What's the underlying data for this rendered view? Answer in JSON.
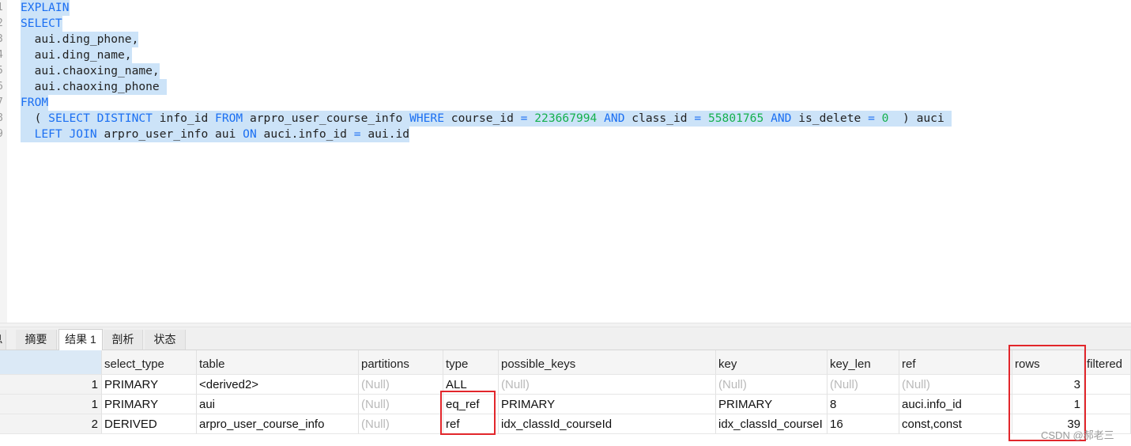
{
  "editor": {
    "line_numbers": [
      "1",
      "2",
      "3",
      "4",
      "5",
      "6",
      "7",
      "8",
      "9"
    ],
    "lines": [
      [
        {
          "t": "EXPLAIN",
          "c": "kw"
        }
      ],
      [
        {
          "t": "SELECT",
          "c": "kw"
        }
      ],
      [
        {
          "t": "  aui.ding_phone,",
          "c": "id"
        }
      ],
      [
        {
          "t": "  aui.ding_name,",
          "c": "id"
        }
      ],
      [
        {
          "t": "  aui.chaoxing_name,",
          "c": "id"
        }
      ],
      [
        {
          "t": "  aui.chaoxing_phone ",
          "c": "id"
        }
      ],
      [
        {
          "t": "FROM",
          "c": "kw"
        }
      ],
      [
        {
          "t": "  ( ",
          "c": "id"
        },
        {
          "t": "SELECT",
          "c": "kw"
        },
        {
          "t": " ",
          "c": "id"
        },
        {
          "t": "DISTINCT",
          "c": "kw"
        },
        {
          "t": " info_id ",
          "c": "id"
        },
        {
          "t": "FROM",
          "c": "kw"
        },
        {
          "t": " arpro_user_course_info ",
          "c": "id"
        },
        {
          "t": "WHERE",
          "c": "kw"
        },
        {
          "t": " course_id ",
          "c": "id"
        },
        {
          "t": "=",
          "c": "kw"
        },
        {
          "t": " ",
          "c": "id"
        },
        {
          "t": "223667994",
          "c": "num"
        },
        {
          "t": " ",
          "c": "id"
        },
        {
          "t": "AND",
          "c": "kw"
        },
        {
          "t": " class_id ",
          "c": "id"
        },
        {
          "t": "=",
          "c": "kw"
        },
        {
          "t": " ",
          "c": "id"
        },
        {
          "t": "55801765",
          "c": "num"
        },
        {
          "t": " ",
          "c": "id"
        },
        {
          "t": "AND",
          "c": "kw"
        },
        {
          "t": " is_delete ",
          "c": "id"
        },
        {
          "t": "=",
          "c": "kw"
        },
        {
          "t": " ",
          "c": "id"
        },
        {
          "t": "0",
          "c": "num"
        },
        {
          "t": "  ) auci ",
          "c": "id"
        }
      ],
      [
        {
          "t": "  ",
          "c": "id"
        },
        {
          "t": "LEFT JOIN",
          "c": "kw"
        },
        {
          "t": " arpro_user_info aui ",
          "c": "id"
        },
        {
          "t": "ON",
          "c": "kw"
        },
        {
          "t": " auci.info_id ",
          "c": "id"
        },
        {
          "t": "=",
          "c": "kw"
        },
        {
          "t": " aui.id",
          "c": "id"
        }
      ]
    ]
  },
  "tabs": [
    {
      "label": "息",
      "active": false
    },
    {
      "label": "摘要",
      "active": false
    },
    {
      "label": "结果 1",
      "active": true
    },
    {
      "label": "剖析",
      "active": false
    },
    {
      "label": "状态",
      "active": false
    }
  ],
  "grid": {
    "columns": [
      "select_type",
      "table",
      "partitions",
      "type",
      "possible_keys",
      "key",
      "key_len",
      "ref",
      "rows",
      "filtered"
    ],
    "rows": [
      {
        "id": "1",
        "select_type": "PRIMARY",
        "table": "<derived2>",
        "partitions": "(Null)",
        "type": "ALL",
        "possible_keys": "(Null)",
        "key": "(Null)",
        "key_len": "(Null)",
        "ref": "(Null)",
        "rows": "3",
        "filtered": ""
      },
      {
        "id": "1",
        "select_type": "PRIMARY",
        "table": "aui",
        "partitions": "(Null)",
        "type": "eq_ref",
        "possible_keys": "PRIMARY",
        "key": "PRIMARY",
        "key_len": "8",
        "ref": "auci.info_id",
        "rows": "1",
        "filtered": ""
      },
      {
        "id": "2",
        "select_type": "DERIVED",
        "table": "arpro_user_course_info",
        "partitions": "(Null)",
        "type": "ref",
        "possible_keys": "idx_classId_courseId",
        "key": "idx_classId_courseI",
        "key_len": "16",
        "ref": "const,const",
        "rows": "39",
        "filtered": ""
      }
    ]
  },
  "watermark": "CSDN @郝老三",
  "colors": {
    "keyword": "#1b6ff2",
    "number": "#15b04d",
    "selection": "#cce3f8",
    "annotation": "#e2262b"
  }
}
